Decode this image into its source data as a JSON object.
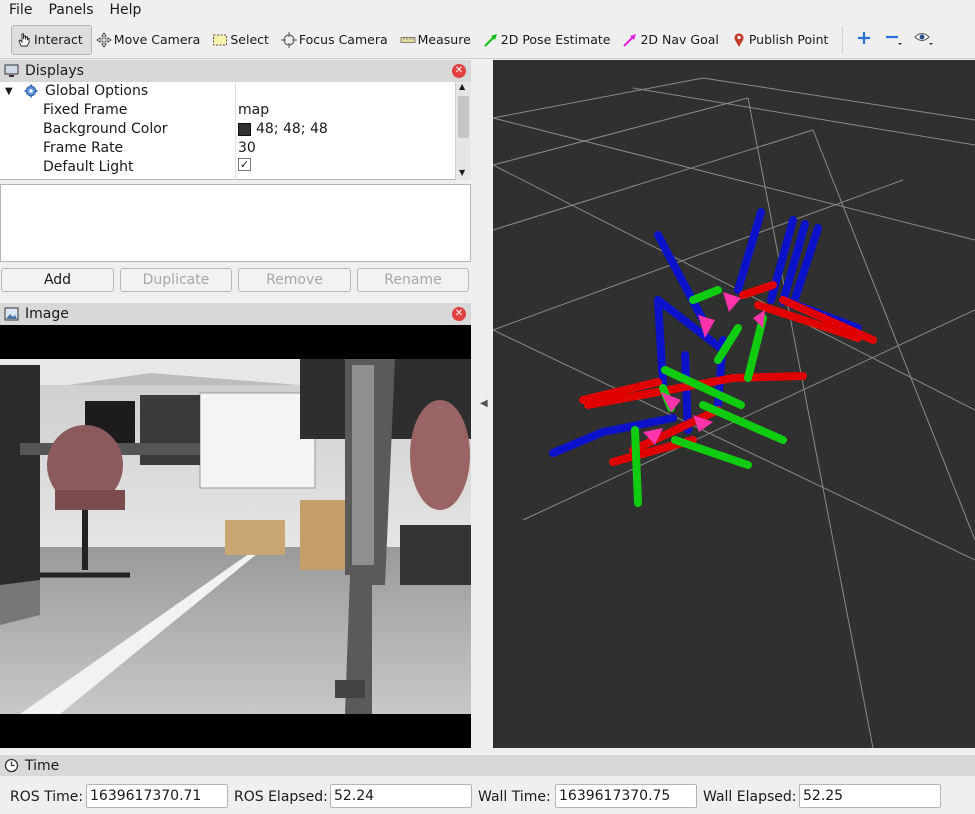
{
  "menu": [
    "File",
    "Panels",
    "Help"
  ],
  "toolbar": {
    "interact": "Interact",
    "move_camera": "Move Camera",
    "select": "Select",
    "focus_camera": "Focus Camera",
    "measure": "Measure",
    "pose_estimate": "2D Pose Estimate",
    "nav_goal": "2D Nav Goal",
    "publish_point": "Publish Point"
  },
  "displays": {
    "title": "Displays",
    "global_options": "Global Options",
    "rows": [
      {
        "key": "Fixed Frame",
        "value": "map"
      },
      {
        "key": "Background Color",
        "value": "48; 48; 48"
      },
      {
        "key": "Frame Rate",
        "value": "30"
      },
      {
        "key": "Default Light",
        "value": "✓"
      }
    ],
    "buttons": {
      "add": "Add",
      "duplicate": "Duplicate",
      "remove": "Remove",
      "rename": "Rename"
    }
  },
  "image_panel": {
    "title": "Image"
  },
  "time": {
    "title": "Time",
    "ros_time_label": "ROS Time:",
    "ros_time": "1639617370.71",
    "ros_elapsed_label": "ROS Elapsed:",
    "ros_elapsed": "52.24",
    "wall_time_label": "Wall Time:",
    "wall_time": "1639617370.75",
    "wall_elapsed_label": "Wall Elapsed:",
    "wall_elapsed": "52.25"
  },
  "colors": {
    "view_bg": "#303030",
    "axis_x": "#e00000",
    "axis_y": "#00d000",
    "axis_z": "#0000e0",
    "arrow": "#ff33aa"
  }
}
